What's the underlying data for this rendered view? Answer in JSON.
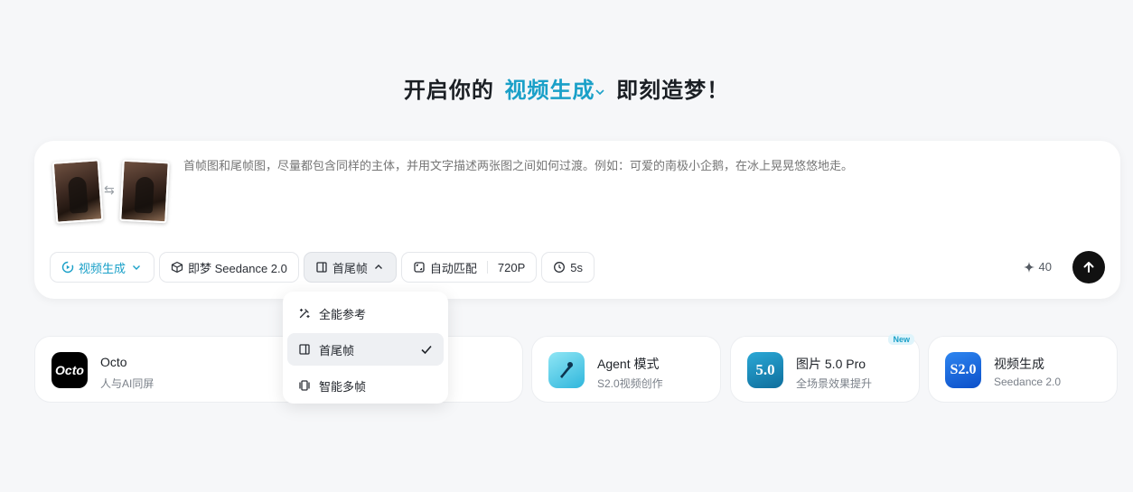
{
  "headline": {
    "prefix": "开启你的",
    "mode": "视频生成",
    "suffix": "即刻造梦！"
  },
  "composer": {
    "swap_symbol": "⇆",
    "prompt_placeholder": "首帧图和尾帧图，尽量都包含同样的主体，并用文字描述两张图之间如何过渡。例如：可爱的南极小企鹅，在冰上晃晃悠悠地走。",
    "prompt_value": "",
    "toolbar": {
      "mode": "视频生成",
      "model": "即梦 Seedance 2.0",
      "frame_mode": "首尾帧",
      "ratio": "自动匹配",
      "resolution": "720P",
      "duration": "5s"
    },
    "credits": "40"
  },
  "frame_menu": {
    "options": [
      {
        "label": "全能参考",
        "icon": "magic-wand-icon",
        "selected": false
      },
      {
        "label": "首尾帧",
        "icon": "frame-icon",
        "selected": true
      },
      {
        "label": "智能多帧",
        "icon": "multi-frame-icon",
        "selected": false
      }
    ]
  },
  "cards": [
    {
      "title": "Octo",
      "subtitle": "人与AI同屏",
      "logo_text": "Octo",
      "logo_color": "#000000",
      "badge": ""
    },
    {
      "title": "",
      "subtitle": "",
      "logo_text": "",
      "logo_color": "#ffffff",
      "badge": ""
    },
    {
      "title": "Agent 模式",
      "subtitle": "S2.0视频创作",
      "logo_text": "",
      "logo_color": "#3fc8e6",
      "badge": ""
    },
    {
      "title": "图片 5.0 Pro",
      "subtitle": "全场景效果提升",
      "logo_text": "5.0",
      "logo_color": "#1b8fbf",
      "badge": "New"
    },
    {
      "title": "视频生成",
      "subtitle": "Seedance 2.0",
      "logo_text": "S2.0",
      "logo_color": "#1660d9",
      "badge": ""
    }
  ],
  "colors": {
    "accent": "#1aa0c8",
    "background": "#f6f7f9",
    "send_button": "#111111"
  }
}
